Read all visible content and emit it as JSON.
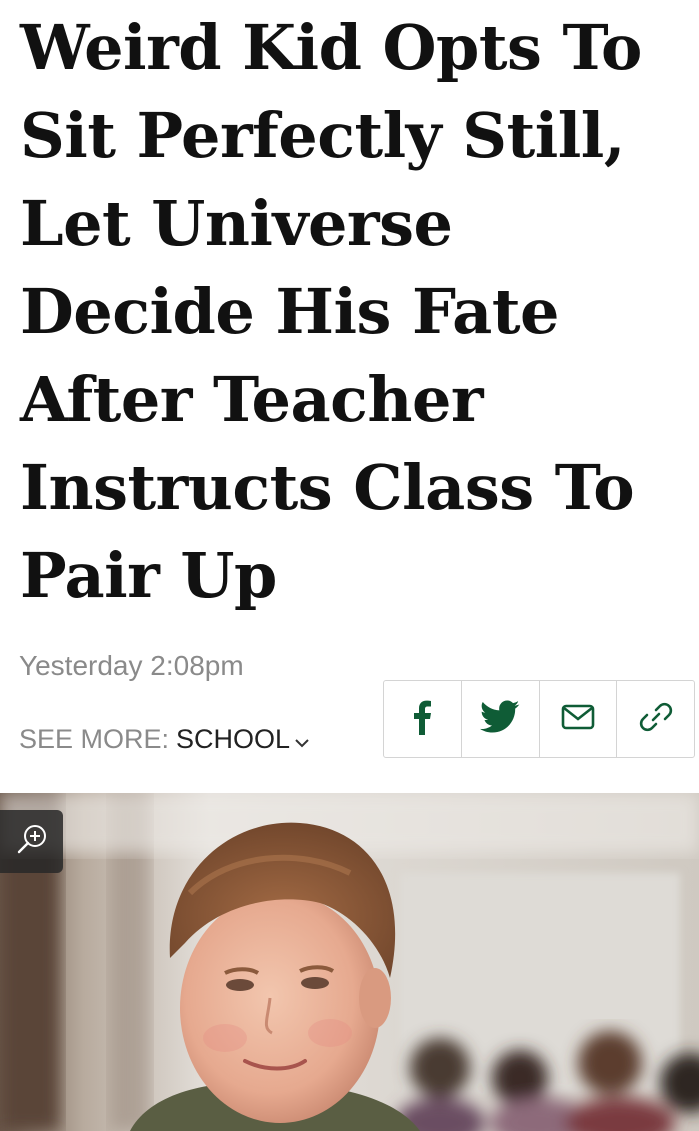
{
  "article": {
    "headline": "Weird Kid Opts To Sit Perfectly Still, Let Universe Decide His Fate After Teacher Instructs Class To Pair Up",
    "timestamp": "Yesterday 2:08pm",
    "see_more_label": "SEE MORE:",
    "topic": "SCHOOL"
  },
  "share": {
    "buttons": [
      {
        "icon": "facebook-icon"
      },
      {
        "icon": "twitter-icon"
      },
      {
        "icon": "email-icon"
      },
      {
        "icon": "link-icon"
      }
    ],
    "icon_color": "#0f5c36"
  },
  "photo": {
    "subject": "boy-in-classroom",
    "zoom_icon": "zoom-in-icon"
  }
}
